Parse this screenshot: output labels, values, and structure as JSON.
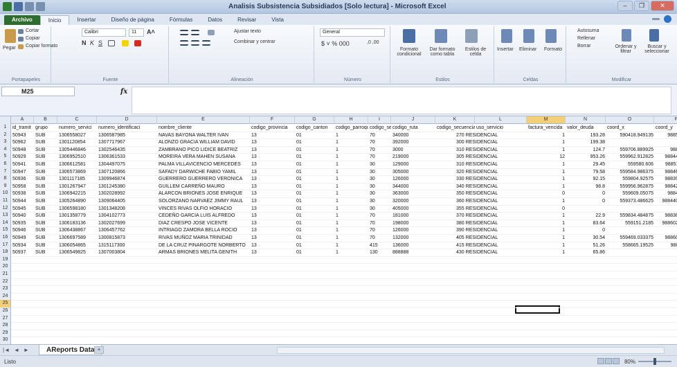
{
  "window": {
    "title": "Analisis Subsistencia Subsidiados [Solo lectura] - Microsoft Excel"
  },
  "tabs": [
    "Archivo",
    "Inicio",
    "Insertar",
    "Diseño de página",
    "Fórmulas",
    "Datos",
    "Revisar",
    "Vista"
  ],
  "ribbon": {
    "clipboard": {
      "label": "Portapapeles",
      "paste": "Pegar",
      "cut": "Cortar",
      "copy": "Copiar",
      "format_painter": "Copiar formato"
    },
    "font": {
      "label": "Fuente",
      "name": "Calibri",
      "size": "11"
    },
    "alignment": {
      "label": "Alineación",
      "wrap": "Ajustar texto",
      "merge": "Combinar y centrar"
    },
    "number": {
      "label": "Número",
      "format": "General"
    },
    "styles": {
      "label": "Estilos",
      "conditional": "Formato condicional",
      "as_table": "Dar formato como tabla",
      "cell_styles": "Estilos de celda"
    },
    "cells": {
      "label": "Celdas",
      "insert": "Insertar",
      "delete": "Eliminar",
      "format": "Formato"
    },
    "editing": {
      "label": "Modificar",
      "autosum": "Autosuma",
      "fill": "Rellenar",
      "clear": "Borrar",
      "sort": "Ordenar y filtrar",
      "find": "Buscar y seleccionar"
    }
  },
  "formula_bar": {
    "name_box": "M25",
    "fx": "fx",
    "value": ""
  },
  "grid": {
    "columns": [
      "A",
      "B",
      "C",
      "D",
      "E",
      "F",
      "G",
      "H",
      "I",
      "J",
      "K",
      "L",
      "M",
      "N",
      "O",
      "P"
    ],
    "header": [
      "id_tramit",
      "grupo",
      "numero_servici",
      "numero_identificaci",
      "nombre_cliente",
      "codigo_provincia",
      "codigo_canton",
      "codigo_parroquia",
      "codigo_sector",
      "codigo_ruta",
      "codigo_secuencial",
      "uso_servicio",
      "factura_vencida",
      "valor_deuda",
      "coord_x",
      "coord_y"
    ],
    "rows": [
      [
        "50943",
        "SUB",
        "1306558027",
        "1306587985",
        "NAVAS BAYONA WALTER IVAN",
        "13",
        "01",
        "1",
        "70",
        "340000",
        "270 RESIDENCIAL",
        "1",
        "193.28",
        "590418.949135",
        "9885929.9715"
      ],
      [
        "50962",
        "SUB",
        "1301120854",
        "1307717967",
        "ALONZO GRACIA WILLIAM DAVID",
        "13",
        "01",
        "1",
        "70",
        "392000",
        "300 RESIDENCIAL",
        "1",
        "199.38",
        "",
        ""
      ],
      [
        "50948",
        "SUB",
        "1305446846",
        "1302546435",
        "ZAMBRANO PICO LIDICE BEATRIZ",
        "13",
        "01",
        "1",
        "70",
        "3000",
        "310 RESIDENCIAL",
        "1",
        "124.7",
        "559706.889925",
        "9884261.832"
      ],
      [
        "50929",
        "SUB",
        "1306952510",
        "1306361533",
        "MOREIRA VERA MAHEN SUSANA",
        "13",
        "01",
        "1",
        "70",
        "219000",
        "305 RESIDENCIAL",
        "12",
        "953.26",
        "559962.912825",
        "9884423.84875"
      ],
      [
        "50941",
        "SUB",
        "1306612581",
        "1304497075",
        "PALMA VILLAVICENCIO MERCEDES",
        "13",
        "01",
        "1",
        "30",
        "129000",
        "310 RESIDENCIAL",
        "1",
        "29.45",
        "559580.606",
        "9885125.11625"
      ],
      [
        "50947",
        "SUB",
        "1306573869",
        "1307120866",
        "SAFADY DARWICHE FABIO YAMIL",
        "13",
        "01",
        "1",
        "30",
        "305000",
        "320 RESIDENCIAL",
        "1",
        "79.58",
        "559584.986375",
        "9884666.08475"
      ],
      [
        "50936",
        "SUB",
        "1301117185",
        "1309946874",
        "GUERRERO GUERRERO VERONICA",
        "13",
        "01",
        "1",
        "30",
        "126000",
        "330 RESIDENCIAL",
        "1",
        "92.15",
        "559804.92575",
        "9883994.68725"
      ],
      [
        "50958",
        "SUB",
        "1301267947",
        "1301245380",
        "GUILLEM CARREÑO MAURO",
        "13",
        "01",
        "1",
        "30",
        "344000",
        "340 RESIDENCIAL",
        "1",
        "98.8",
        "559956.962875",
        "9884258.06875"
      ],
      [
        "50938",
        "SUB",
        "1306942215",
        "1302028992",
        "ALARCON BRIONES JOSE ENRIQUE",
        "13",
        "01",
        "1",
        "30",
        "363000",
        "350 RESIDENCIAL",
        "0",
        "0",
        "559609.05075",
        "9884441.9215"
      ],
      [
        "50944",
        "SUB",
        "1305264890",
        "1309064405",
        "SOLORZANO NARVAEZ JIMMY RAUL",
        "13",
        "01",
        "1",
        "30",
        "320000",
        "360 RESIDENCIAL",
        "1",
        "0",
        "559373.486625",
        "9884408.083625"
      ],
      [
        "50945",
        "SUB",
        "1306598180",
        "1301348208",
        "VINCES RIVAS OLFIO HORACIO",
        "13",
        "01",
        "1",
        "30",
        "405000",
        "355 RESIDENCIAL",
        "0",
        "",
        "",
        ""
      ],
      [
        "50940",
        "SUB",
        "1301358779",
        "1304102773",
        "CEDEÑO GARCIA LUIS ALFREDO",
        "13",
        "01",
        "1",
        "70",
        "181000",
        "370 RESIDENCIAL",
        "1",
        "22.9",
        "559834.484875",
        "9883642.98775"
      ],
      [
        "50935",
        "SUB",
        "1306183136",
        "1302027699",
        "DIAZ CRESPO JOSE VICENTE",
        "13",
        "01",
        "1",
        "70",
        "198000",
        "380 RESIDENCIAL",
        "1",
        "83.64",
        "559151.2185",
        "9886028.943875"
      ],
      [
        "50946",
        "SUB",
        "1306438867",
        "1306457762",
        "INTRIAGO ZAMORA BELLA ROCIO",
        "13",
        "01",
        "1",
        "70",
        "126000",
        "390 RESIDENCIAL",
        "1",
        "0",
        "",
        ""
      ],
      [
        "50949",
        "SUB",
        "1306697589",
        "1300815873",
        "RIVAS MUÑOZ MARIA TRINIDAD",
        "13",
        "01",
        "1",
        "70",
        "132000",
        "405 RESIDENCIAL",
        "1",
        "30.54",
        "559469.033375",
        "9886016.32775"
      ],
      [
        "50934",
        "SUB",
        "1306054865",
        "1315117300",
        "DE LA CRUZ PINARGOTE NORBERTO",
        "13",
        "01",
        "1",
        "415",
        "136000",
        "415 RESIDENCIAL",
        "1",
        "51.26",
        "558665.19525",
        "9885371.011"
      ],
      [
        "50937",
        "SUB",
        "1306549825",
        "1307003804",
        "ARMAS BRIONES MELITA GENITH",
        "13",
        "01",
        "1",
        "130",
        "888888",
        "430 RESIDENCIAL",
        "1",
        "65.86",
        "",
        ""
      ]
    ],
    "row_numbers": [
      "1",
      "2",
      "3",
      "4",
      "5",
      "6",
      "7",
      "8",
      "9",
      "10",
      "11",
      "12",
      "13",
      "14",
      "15",
      "16",
      "17",
      "18",
      "19",
      "20",
      "21",
      "22",
      "23",
      "24",
      "25",
      "26",
      "27",
      "28",
      "29",
      "30"
    ]
  },
  "sheet_tabs": {
    "active": "AReports Data"
  },
  "status": {
    "mode": "Listo",
    "zoom": "80%"
  },
  "colors": {
    "file_tab": "#2e6c2f",
    "selected_header": "#f3cf7a",
    "accent": "#2d72c5"
  }
}
